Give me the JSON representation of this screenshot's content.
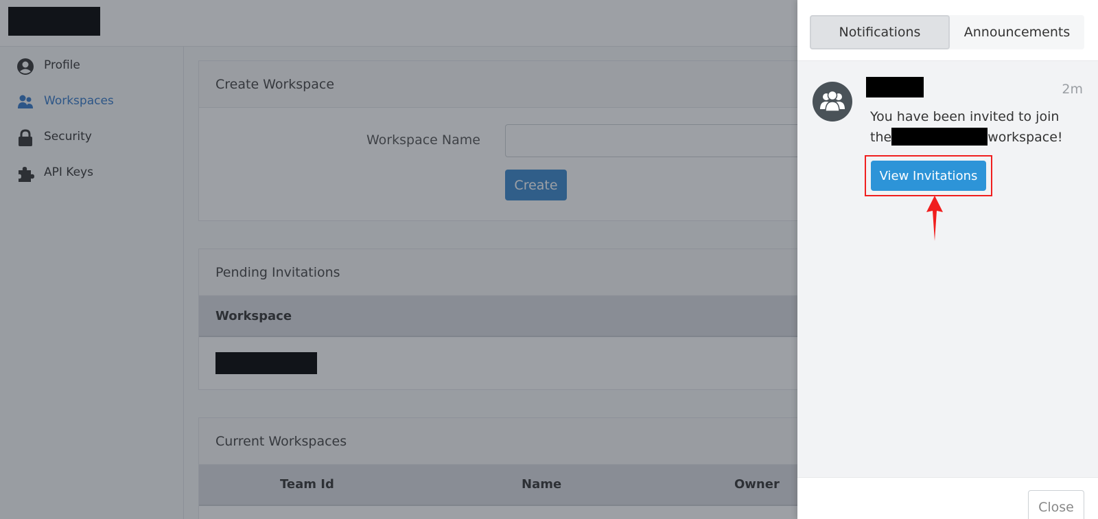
{
  "sidebar": {
    "items": [
      {
        "label": "Profile",
        "icon": "user-circle-icon"
      },
      {
        "label": "Workspaces",
        "icon": "users-icon"
      },
      {
        "label": "Security",
        "icon": "lock-icon"
      },
      {
        "label": "API Keys",
        "icon": "puzzle-icon"
      }
    ],
    "active_index": 1
  },
  "create_workspace": {
    "title": "Create Workspace",
    "name_label": "Workspace Name",
    "name_value": "",
    "create_label": "Create"
  },
  "pending_invitations": {
    "title": "Pending Invitations",
    "column": "Workspace"
  },
  "current_workspaces": {
    "title": "Current Workspaces",
    "columns": [
      "Team Id",
      "Name",
      "Owner"
    ]
  },
  "panel": {
    "tabs": [
      "Notifications",
      "Announcements"
    ],
    "active_tab": "Notifications",
    "notification": {
      "time": "2m",
      "message_before": "You have been invited to join the",
      "message_after": "workspace!",
      "action_label": "View Invitations"
    },
    "close_label": "Close"
  },
  "colors": {
    "accent": "#2d94d8",
    "highlight": "#f01e1e",
    "active_nav": "#3478c8"
  }
}
